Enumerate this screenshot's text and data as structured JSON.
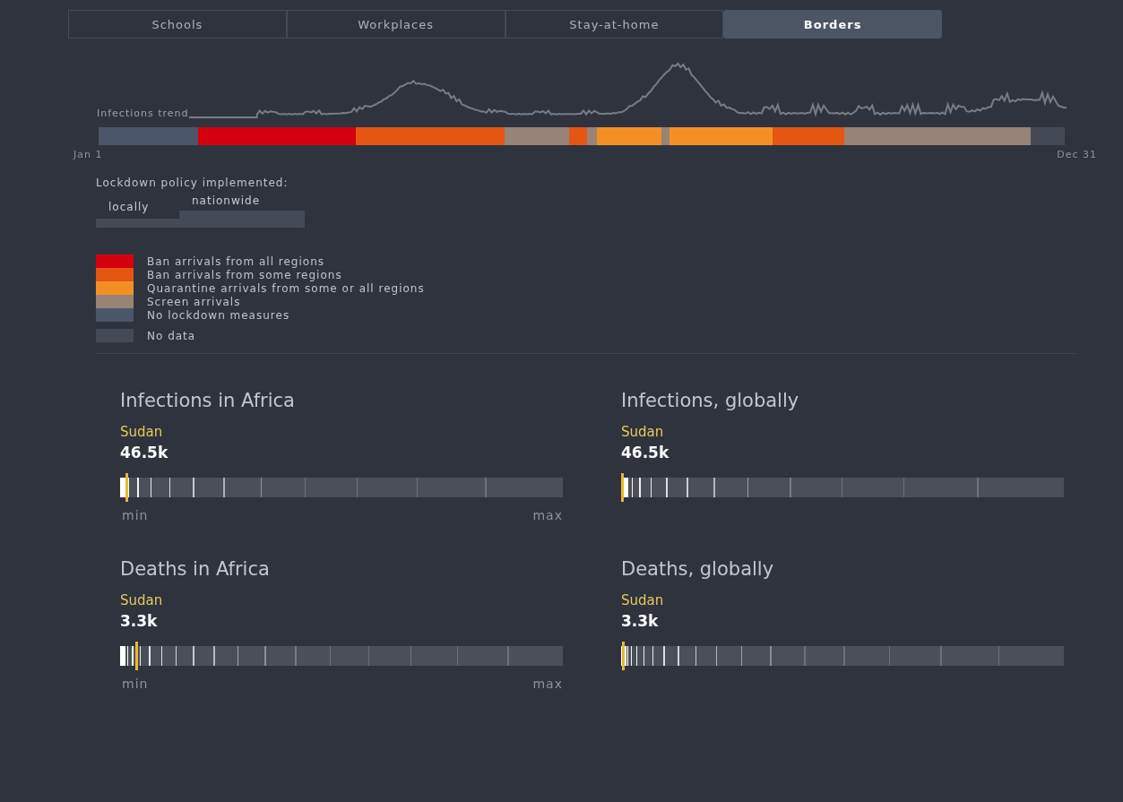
{
  "tabs": [
    {
      "label": "Schools",
      "selected": false
    },
    {
      "label": "Workplaces",
      "selected": false
    },
    {
      "label": "Stay-at-home",
      "selected": false
    },
    {
      "label": "Borders",
      "selected": true
    }
  ],
  "timeline": {
    "trend_label": "Infections trend",
    "start_label": "Jan 1",
    "end_label": "Dec 31",
    "segments": [
      {
        "kind": "no-lockdown"
      },
      {
        "kind": "ban-all"
      },
      {
        "kind": "ban-some"
      },
      {
        "kind": "screen"
      },
      {
        "kind": "ban-some"
      },
      {
        "kind": "screen"
      },
      {
        "kind": "quarantine"
      },
      {
        "kind": "screen"
      },
      {
        "kind": "quarantine"
      },
      {
        "kind": "ban-some"
      },
      {
        "kind": "screen"
      },
      {
        "kind": "no-data"
      }
    ]
  },
  "lockdown_legend": {
    "title": "Lockdown policy implemented:",
    "locally": "locally",
    "nationwide": "nationwide"
  },
  "legend": [
    {
      "kind": "ban-all",
      "label": "Ban arrivals from all regions"
    },
    {
      "kind": "ban-some",
      "label": "Ban arrivals from some regions"
    },
    {
      "kind": "quarantine",
      "label": "Quarantine arrivals from some or all regions"
    },
    {
      "kind": "screen",
      "label": "Screen arrivals"
    },
    {
      "kind": "no-lockdown",
      "label": "No lockdown measures"
    },
    {
      "kind": "no-data",
      "label": "No data"
    }
  ],
  "panels": [
    {
      "title": "Infections in Africa",
      "country": "Sudan",
      "value": "46.5k",
      "level": 0.014,
      "min_label": "min",
      "max_label": "max"
    },
    {
      "title": "Infections, globally",
      "country": "Sudan",
      "value": "46.5k",
      "level": 0.002
    },
    {
      "title": "Deaths in Africa",
      "country": "Sudan",
      "value": "3.3k",
      "level": 0.036,
      "min_label": "min",
      "max_label": "max"
    },
    {
      "title": "Deaths, globally",
      "country": "Sudan",
      "value": "3.3k",
      "level": 0.004
    }
  ]
}
